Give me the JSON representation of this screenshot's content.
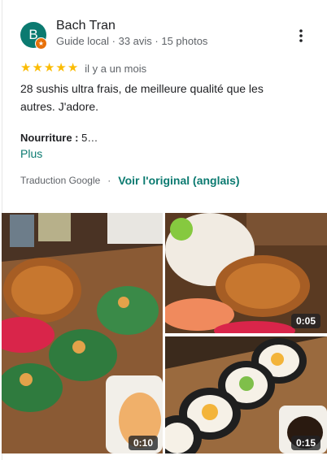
{
  "reviewer": {
    "name": "Bach Tran",
    "avatar_letter": "B",
    "meta": "Guide local · 33 avis · 15 photos"
  },
  "rating": {
    "stars": 5,
    "time": "il y a un mois"
  },
  "review": {
    "text": "28 sushis ultra frais, de meilleure qualité que les autres. J'adore.",
    "food_label": "Nourriture :",
    "food_value": "5…",
    "more_label": "Plus"
  },
  "translation": {
    "label": "Traduction Google",
    "separator": "·",
    "original_link": "Voir l'original (anglais)"
  },
  "photos": [
    {
      "duration": "0:10"
    },
    {
      "duration": "0:05"
    },
    {
      "duration": "0:15"
    }
  ],
  "colors": {
    "accent": "#0b7a70",
    "star": "#fbbc04",
    "badge": "#e8710a"
  }
}
